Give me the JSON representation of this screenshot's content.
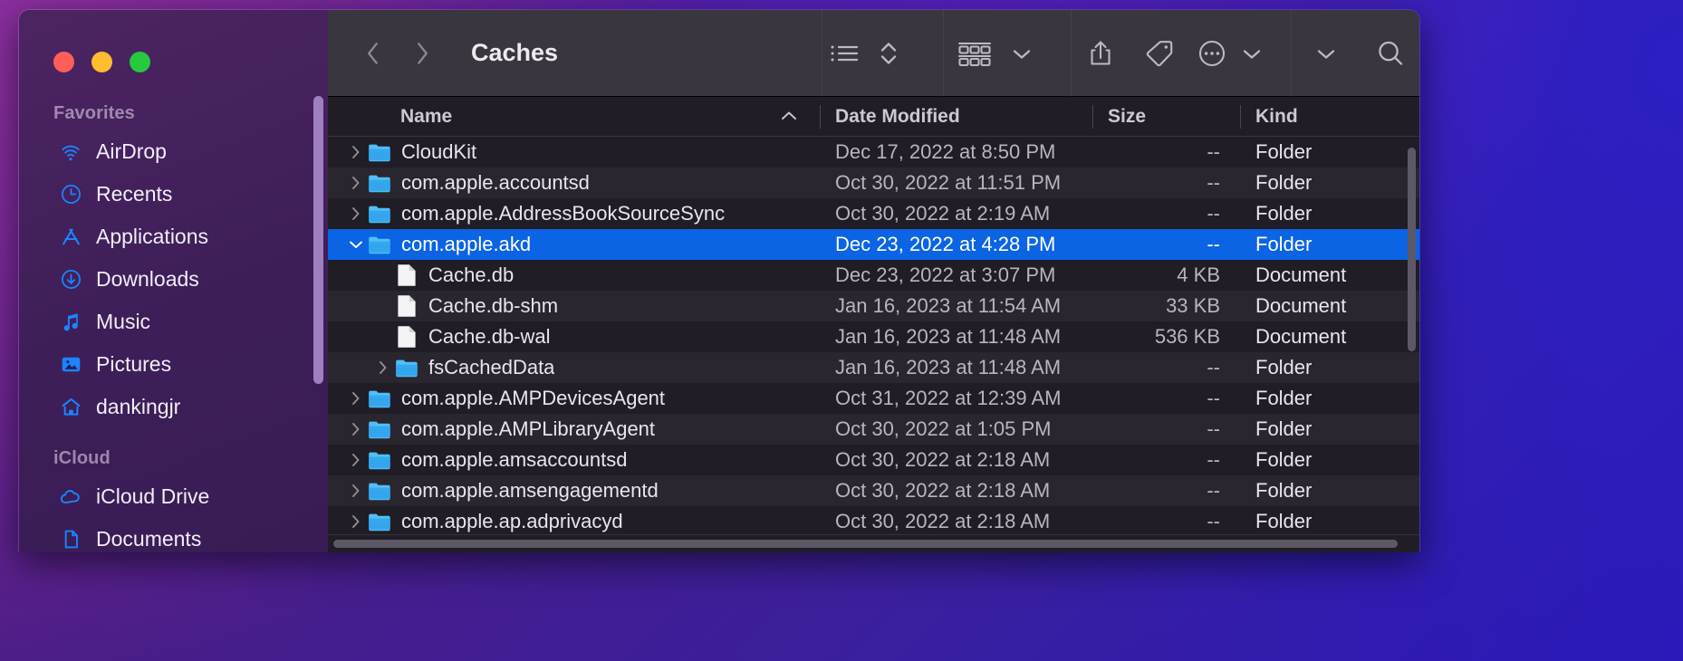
{
  "window": {
    "traffic_lights": [
      "close",
      "minimize",
      "zoom"
    ]
  },
  "toolbar": {
    "back_label": "Back",
    "forward_label": "Forward",
    "title": "Caches",
    "view_list_label": "List View",
    "sort_label": "Sort",
    "group_label": "Group",
    "group_chevron_label": "Group options",
    "share_label": "Share",
    "tag_label": "Tags",
    "more_label": "More",
    "more_chevron_label": "More options",
    "overflow_label": "Toolbar overflow",
    "search_label": "Search"
  },
  "sidebar": {
    "sections": [
      {
        "title": "Favorites",
        "items": [
          {
            "label": "AirDrop",
            "icon": "airdrop-icon"
          },
          {
            "label": "Recents",
            "icon": "clock-icon"
          },
          {
            "label": "Applications",
            "icon": "applications-icon"
          },
          {
            "label": "Downloads",
            "icon": "download-circle-icon"
          },
          {
            "label": "Music",
            "icon": "music-note-icon"
          },
          {
            "label": "Pictures",
            "icon": "pictures-icon"
          },
          {
            "label": "dankingjr",
            "icon": "home-icon"
          }
        ]
      },
      {
        "title": "iCloud",
        "items": [
          {
            "label": "iCloud Drive",
            "icon": "cloud-icon"
          },
          {
            "label": "Documents",
            "icon": "document-icon"
          }
        ]
      }
    ]
  },
  "columns": {
    "name": "Name",
    "date_modified": "Date Modified",
    "size": "Size",
    "kind": "Kind",
    "sort_indicator": "ascending"
  },
  "files": [
    {
      "name": "CloudKit",
      "date": "Dec 17, 2022 at 8:50 PM",
      "size": "--",
      "kind": "Folder",
      "icon": "folder-icon",
      "twisty": "collapsed",
      "indent": 0,
      "selected": false
    },
    {
      "name": "com.apple.accountsd",
      "date": "Oct 30, 2022 at 11:51 PM",
      "size": "--",
      "kind": "Folder",
      "icon": "folder-icon",
      "twisty": "collapsed",
      "indent": 0,
      "selected": false
    },
    {
      "name": "com.apple.AddressBookSourceSync",
      "date": "Oct 30, 2022 at 2:19 AM",
      "size": "--",
      "kind": "Folder",
      "icon": "folder-icon",
      "twisty": "collapsed",
      "indent": 0,
      "selected": false
    },
    {
      "name": "com.apple.akd",
      "date": "Dec 23, 2022 at 4:28 PM",
      "size": "--",
      "kind": "Folder",
      "icon": "folder-icon",
      "twisty": "expanded",
      "indent": 0,
      "selected": true
    },
    {
      "name": "Cache.db",
      "date": "Dec 23, 2022 at 3:07 PM",
      "size": "4 KB",
      "kind": "Document",
      "icon": "document-icon",
      "twisty": "none",
      "indent": 1,
      "selected": false
    },
    {
      "name": "Cache.db-shm",
      "date": "Jan 16, 2023 at 11:54 AM",
      "size": "33 KB",
      "kind": "Document",
      "icon": "document-icon",
      "twisty": "none",
      "indent": 1,
      "selected": false
    },
    {
      "name": "Cache.db-wal",
      "date": "Jan 16, 2023 at 11:48 AM",
      "size": "536 KB",
      "kind": "Document",
      "icon": "document-icon",
      "twisty": "none",
      "indent": 1,
      "selected": false
    },
    {
      "name": "fsCachedData",
      "date": "Jan 16, 2023 at 11:48 AM",
      "size": "--",
      "kind": "Folder",
      "icon": "folder-icon",
      "twisty": "collapsed",
      "indent": 1,
      "selected": false
    },
    {
      "name": "com.apple.AMPDevicesAgent",
      "date": "Oct 31, 2022 at 12:39 AM",
      "size": "--",
      "kind": "Folder",
      "icon": "folder-icon",
      "twisty": "collapsed",
      "indent": 0,
      "selected": false
    },
    {
      "name": "com.apple.AMPLibraryAgent",
      "date": "Oct 30, 2022 at 1:05 PM",
      "size": "--",
      "kind": "Folder",
      "icon": "folder-icon",
      "twisty": "collapsed",
      "indent": 0,
      "selected": false
    },
    {
      "name": "com.apple.amsaccountsd",
      "date": "Oct 30, 2022 at 2:18 AM",
      "size": "--",
      "kind": "Folder",
      "icon": "folder-icon",
      "twisty": "collapsed",
      "indent": 0,
      "selected": false
    },
    {
      "name": "com.apple.amsengagementd",
      "date": "Oct 30, 2022 at 2:18 AM",
      "size": "--",
      "kind": "Folder",
      "icon": "folder-icon",
      "twisty": "collapsed",
      "indent": 0,
      "selected": false
    },
    {
      "name": "com.apple.ap.adprivacyd",
      "date": "Oct 30, 2022 at 2:18 AM",
      "size": "--",
      "kind": "Folder",
      "icon": "folder-icon",
      "twisty": "collapsed",
      "indent": 0,
      "selected": false
    }
  ],
  "colors": {
    "selection": "#0a64e4",
    "sidebar_accent": "#1a85ff",
    "folder": "#3aaef2",
    "toolbar_bg": "#3a363f",
    "list_bg": "#211d26"
  }
}
